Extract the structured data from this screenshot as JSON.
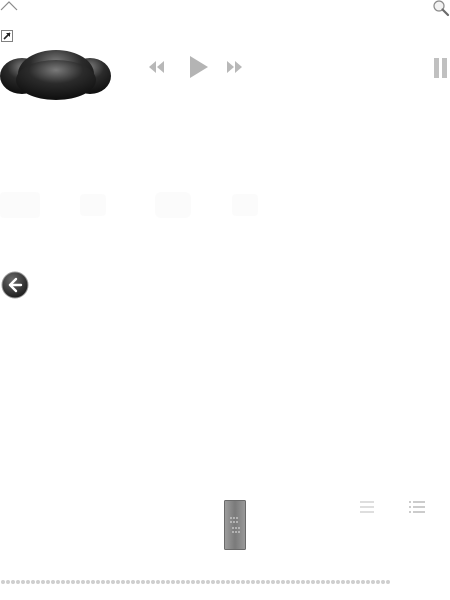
{
  "icons": {
    "collapse": "chevron-up-icon",
    "search": "magnifier-icon",
    "shortcut": "shortcut-arrow-icon",
    "cloud": "cloud-shape-icon",
    "rewind": "rewind-icon",
    "play": "play-icon",
    "fast_forward": "fast-forward-icon",
    "pause": "pause-icon",
    "back": "back-arrow-icon",
    "grip": "grip-handle-icon",
    "list": "list-icon",
    "list_indented": "indented-list-icon"
  },
  "colors": {
    "control_gray": "#b0b0b0",
    "cloud_dark": "#151515",
    "dots": "#cfcfcf"
  }
}
